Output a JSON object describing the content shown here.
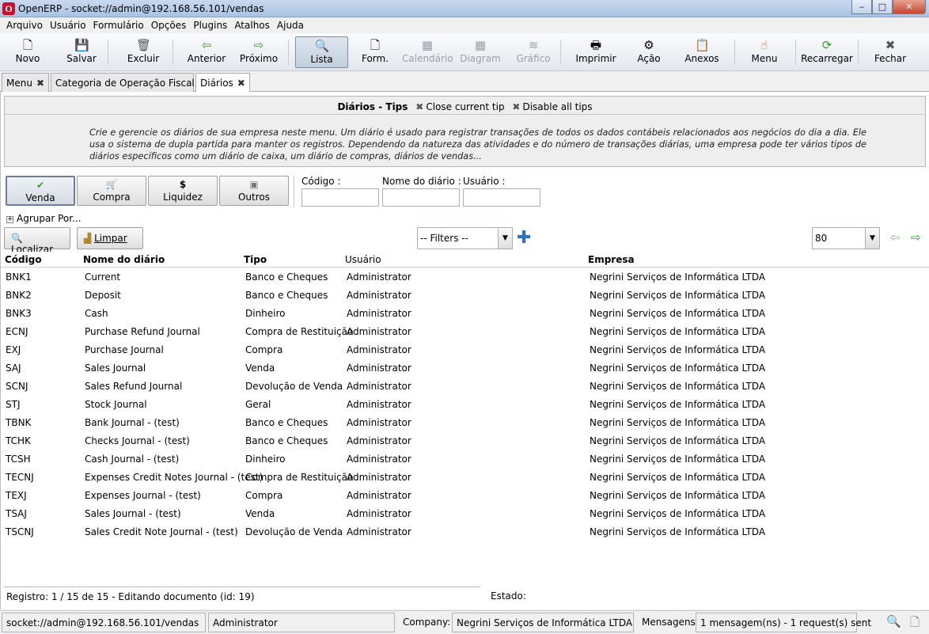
{
  "window": {
    "title": "OpenERP - socket://admin@192.168.56.101/vendas",
    "logo": "O",
    "min": "‒",
    "max": "□",
    "close": "✕"
  },
  "menu": [
    "Arquivo",
    "Usuário",
    "Formulário",
    "Opções",
    "Plugins",
    "Atalhos",
    "Ajuda"
  ],
  "toolbar": [
    {
      "label": "Novo",
      "icon": "new-document-icon",
      "glyph": "🗋",
      "enabled": true
    },
    {
      "label": "Salvar",
      "icon": "save-icon",
      "glyph": "💾",
      "enabled": true
    },
    {
      "label": "Excluir",
      "icon": "trash-icon",
      "glyph": "🗑",
      "enabled": true
    },
    {
      "label": "Anterior",
      "icon": "arrow-left-icon",
      "glyph": "⇦",
      "enabled": true
    },
    {
      "label": "Próximo",
      "icon": "arrow-right-icon",
      "glyph": "⇨",
      "enabled": true
    },
    {
      "label": "Lista",
      "icon": "search-list-icon",
      "glyph": "🔍",
      "enabled": true,
      "active": true
    },
    {
      "label": "Form.",
      "icon": "form-icon",
      "glyph": "🗋",
      "enabled": true
    },
    {
      "label": "Calendário",
      "icon": "calendar-icon",
      "glyph": "▦",
      "enabled": false
    },
    {
      "label": "Diagram",
      "icon": "diagram-icon",
      "glyph": "▦",
      "enabled": false
    },
    {
      "label": "Gráfico",
      "icon": "chart-icon",
      "glyph": "≋",
      "enabled": false
    },
    {
      "label": "Imprimir",
      "icon": "printer-icon",
      "glyph": "🖶",
      "enabled": true
    },
    {
      "label": "Ação",
      "icon": "gears-icon",
      "glyph": "⚙",
      "enabled": true
    },
    {
      "label": "Anexos",
      "icon": "clipboard-icon",
      "glyph": "📋",
      "enabled": true
    },
    {
      "label": "Menu",
      "icon": "hand-menu-icon",
      "glyph": "☝",
      "enabled": true
    },
    {
      "label": "Recarregar",
      "icon": "reload-icon",
      "glyph": "⟳",
      "enabled": true
    },
    {
      "label": "Fechar",
      "icon": "close-icon",
      "glyph": "✖",
      "enabled": true
    }
  ],
  "tabs": [
    {
      "label": "Menu",
      "selected": false
    },
    {
      "label": "Categoria de Operação Fiscal",
      "selected": false
    },
    {
      "label": "Diários",
      "selected": true
    }
  ],
  "tips": {
    "title": "Diários - Tips",
    "close_current": "Close current tip",
    "disable_all": "Disable all tips",
    "text": "Crie e gerencie os diários de sua empresa neste menu. Um diário é usado para registrar transações de todos os dados contábeis relacionados aos negócios do dia a dia. Ele usa o sistema de dupla partida para manter os registros. Dependendo da natureza das atividades e do número de transações diárias, uma empresa pode ter vários tipos de diários específicos como um diário de caixa, um diário de compras, diários de vendas..."
  },
  "filters": [
    {
      "label": "Venda",
      "glyph": "✔",
      "selected": true
    },
    {
      "label": "Compra",
      "glyph": "🛒",
      "selected": false
    },
    {
      "label": "Liquidez",
      "glyph": "$",
      "selected": false
    },
    {
      "label": "Outros",
      "glyph": "▣",
      "selected": false
    }
  ],
  "search": {
    "codigo_label": "Código :",
    "codigo_value": "",
    "nome_label": "Nome do diário :",
    "nome_value": "",
    "usuario_label": "Usuário :",
    "usuario_value": ""
  },
  "agrupar": "Agrupar Por...",
  "actions": {
    "localizar": "Localizar",
    "limpar": "Limpar",
    "filters_value": "-- Filters --",
    "limit_value": "80"
  },
  "columns": [
    "Código",
    "Nome do diário",
    "Tipo",
    "Usuário",
    "Empresa"
  ],
  "rows": [
    [
      "BNK1",
      "Current",
      "Banco e Cheques",
      "Administrator",
      "Negrini Serviços de Informática LTDA"
    ],
    [
      "BNK2",
      "Deposit",
      "Banco e Cheques",
      "Administrator",
      "Negrini Serviços de Informática LTDA"
    ],
    [
      "BNK3",
      "Cash",
      "Dinheiro",
      "Administrator",
      "Negrini Serviços de Informática LTDA"
    ],
    [
      "ECNJ",
      "Purchase Refund Journal",
      "Compra de Restituição",
      "Administrator",
      "Negrini Serviços de Informática LTDA"
    ],
    [
      "EXJ",
      "Purchase Journal",
      "Compra",
      "Administrator",
      "Negrini Serviços de Informática LTDA"
    ],
    [
      "SAJ",
      "Sales Journal",
      "Venda",
      "Administrator",
      "Negrini Serviços de Informática LTDA"
    ],
    [
      "SCNJ",
      "Sales Refund Journal",
      "Devolução de Venda",
      "Administrator",
      "Negrini Serviços de Informática LTDA"
    ],
    [
      "STJ",
      "Stock Journal",
      "Geral",
      "Administrator",
      "Negrini Serviços de Informática LTDA"
    ],
    [
      "TBNK",
      "Bank Journal - (test)",
      "Banco e Cheques",
      "Administrator",
      "Negrini Serviços de Informática LTDA"
    ],
    [
      "TCHK",
      "Checks Journal - (test)",
      "Banco e Cheques",
      "Administrator",
      "Negrini Serviços de Informática LTDA"
    ],
    [
      "TCSH",
      "Cash Journal - (test)",
      "Dinheiro",
      "Administrator",
      "Negrini Serviços de Informática LTDA"
    ],
    [
      "TECNJ",
      "Expenses Credit Notes Journal - (test)",
      "Compra de Restituição",
      "Administrator",
      "Negrini Serviços de Informática LTDA"
    ],
    [
      "TEXJ",
      "Expenses Journal - (test)",
      "Compra",
      "Administrator",
      "Negrini Serviços de Informática LTDA"
    ],
    [
      "TSAJ",
      "Sales Journal - (test)",
      "Venda",
      "Administrator",
      "Negrini Serviços de Informática LTDA"
    ],
    [
      "TSCNJ",
      "Sales Credit Note Journal - (test)",
      "Devolução de Venda",
      "Administrator",
      "Negrini Serviços de Informática LTDA"
    ]
  ],
  "status": {
    "registro": "Registro: 1 / 15 de 15 - Editando documento (id: 19)",
    "estado": "Estado:"
  },
  "bottom": {
    "connection": "socket://admin@192.168.56.101/vendas",
    "user": "Administrator",
    "company_label": "Company:",
    "company": "Negrini Serviços de Informática LTDA",
    "messages_label": "Mensagens:",
    "messages": "1 mensagem(ns) - 1 request(s) sent"
  }
}
